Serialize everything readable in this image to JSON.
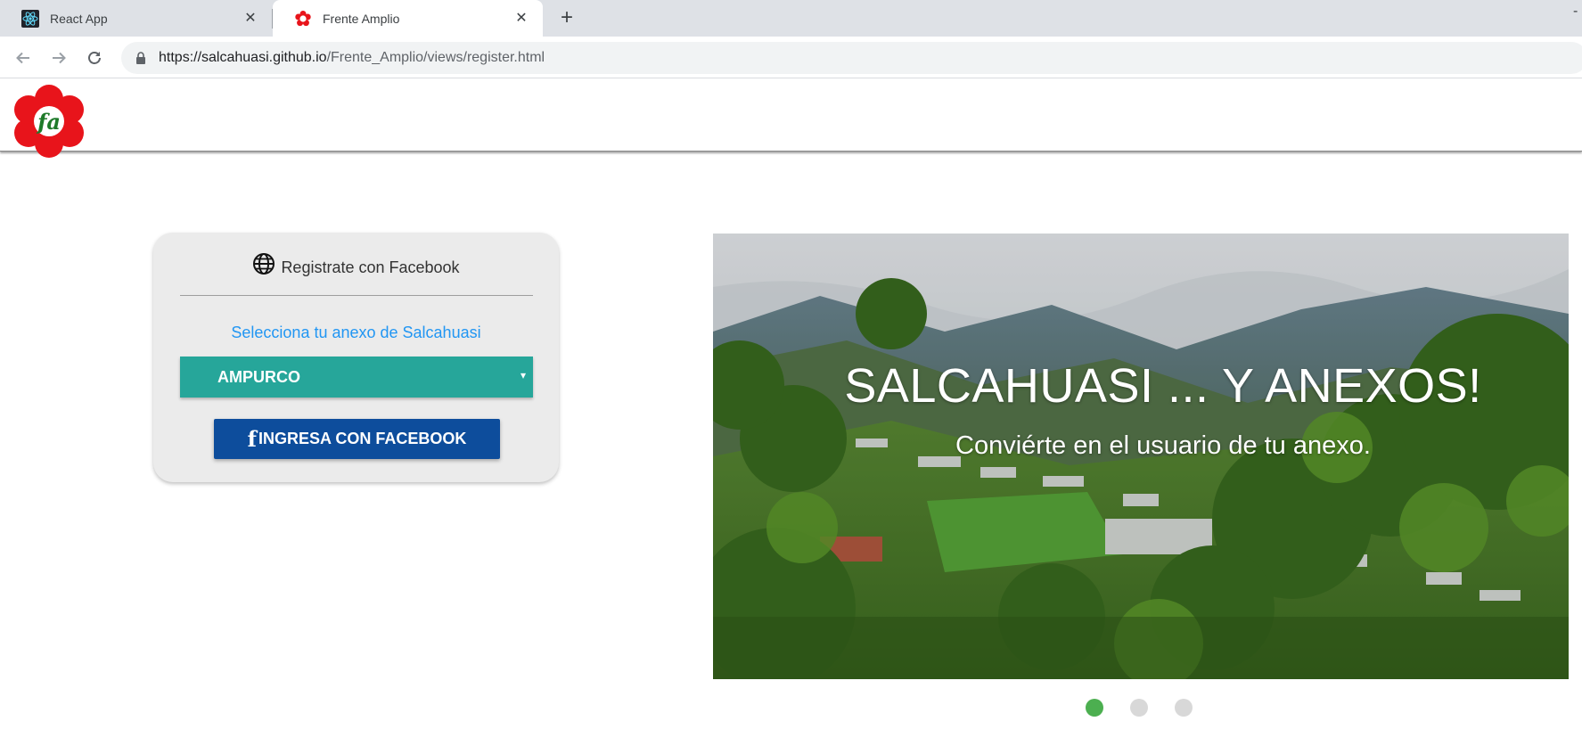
{
  "browser": {
    "tabs": [
      {
        "title": "React App",
        "icon": "react-icon",
        "active": false
      },
      {
        "title": "Frente Amplio",
        "icon": "frente-amplio-flower-icon",
        "active": true
      }
    ],
    "new_tab_label": "+",
    "close_label": "✕",
    "url_host": "https://salcahuasi.github.io",
    "url_path": "/Frente_Amplio/views/register.html"
  },
  "header": {
    "logo_text": "fa",
    "logo_petal_color": "#e8141b",
    "logo_text_color": "#1f7a2a"
  },
  "register": {
    "title": "Registrate con Facebook",
    "annex_label": "Selecciona tu anexo de Salcahuasi",
    "annex_selected": "AMPURCO",
    "annex_caret": "▾",
    "fb_icon_glyph": "f",
    "fb_button_label": "INGRESA CON FACEBOOK"
  },
  "slider": {
    "title": "SALCAHUASI ... Y ANEXOS!",
    "subtitle": "Conviérte en el usuario de tu anexo.",
    "active_index": 0,
    "dot_count": 3,
    "active_dot_color": "#4caf50",
    "inactive_dot_color": "#d8d8d8"
  },
  "colors": {
    "annex_select_bg": "#26a69a",
    "fb_button_bg": "#0d4d9c",
    "annex_label": "#2196f3"
  }
}
